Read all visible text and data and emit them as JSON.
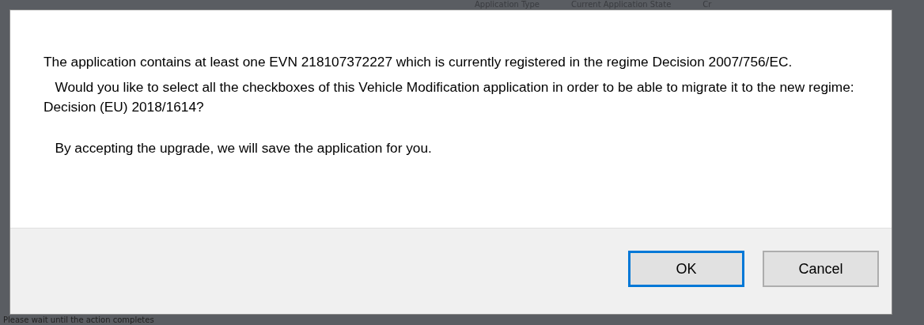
{
  "background": {
    "column_headers": [
      "Application Type",
      "Current Application State",
      "Cr"
    ],
    "status_text": "Please wait until the action completes"
  },
  "dialog": {
    "message": [
      "The application contains at least one EVN 218107372227 which is currently registered in the regime Decision 2007/756/EC.",
      "   Would you like to select all the checkboxes of this Vehicle Modification application in order to be able to migrate it to the new regime: Decision (EU) 2018/1614?",
      "   By accepting the upgrade, we will save the application for you."
    ],
    "buttons": [
      {
        "label": "OK",
        "focused": true
      },
      {
        "label": "Cancel",
        "focused": false
      }
    ]
  }
}
